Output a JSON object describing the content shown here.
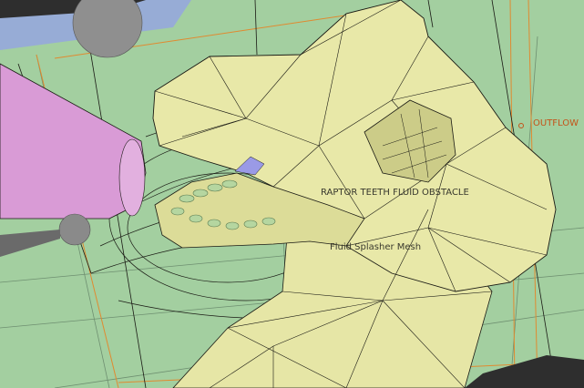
{
  "viewport": {
    "background": "#a3cfa0",
    "floor_color": "#9bc4a2",
    "sky_band_color": "#97acd6",
    "mesh_fill": "#e8e8a8",
    "mesh_shade": "#d4d48c",
    "wire_color": "#1a1a14",
    "cone_color": "#d99bd6",
    "teeth_color": "#b5d6a0",
    "tongue_color": "#9a9ae6",
    "sphere_color": "#8f8f8f",
    "domain_box_color": "#e08a30"
  },
  "labels": {
    "teeth": "RAPTOR TEETH FLUID OBSTACLE",
    "splasher": "Fluid Splasher Mesh",
    "outflow": "OUTFLOW"
  }
}
